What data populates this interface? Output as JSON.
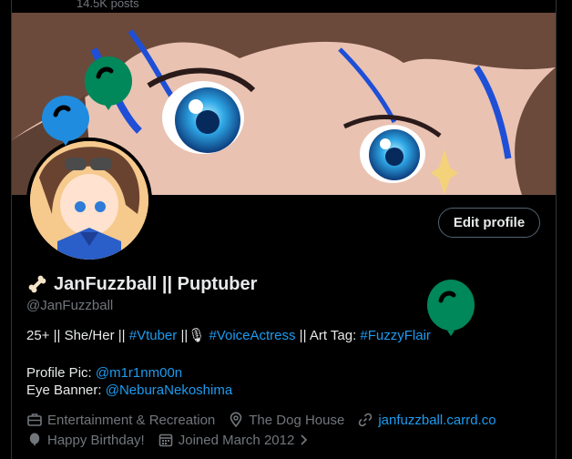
{
  "header": {
    "post_count": "14.5K posts"
  },
  "banner": {
    "alt": "Illustrated anime eyes with brown and blue hair"
  },
  "profile": {
    "display_name": "JanFuzzball || Puptuber",
    "handle": "@JanFuzzball",
    "edit_button_label": "Edit profile"
  },
  "bio": {
    "part1": "25+ || She/Her || ",
    "hashtag1": "#Vtuber",
    "part2": " ||",
    "mic_emoji": "🎙",
    "hashtag2": "#VoiceActress",
    "part3": " || Art Tag: ",
    "hashtag3": "#FuzzyFlair"
  },
  "credits": {
    "pic_label": "Profile Pic: ",
    "pic_handle": "@m1r1nm00n",
    "banner_label": "Eye Banner: ",
    "banner_handle": "@NeburaNekoshima"
  },
  "meta": {
    "category": "Entertainment & Recreation",
    "location": "The Dog House",
    "website": "janfuzzball.carrd.co",
    "birthday": "Happy Birthday!",
    "joined": "Joined March 2012"
  },
  "colors": {
    "accent": "#1d9bf0",
    "muted": "#71767b",
    "balloon_green": "#00875a",
    "balloon_blue": "#1f8ce0"
  }
}
